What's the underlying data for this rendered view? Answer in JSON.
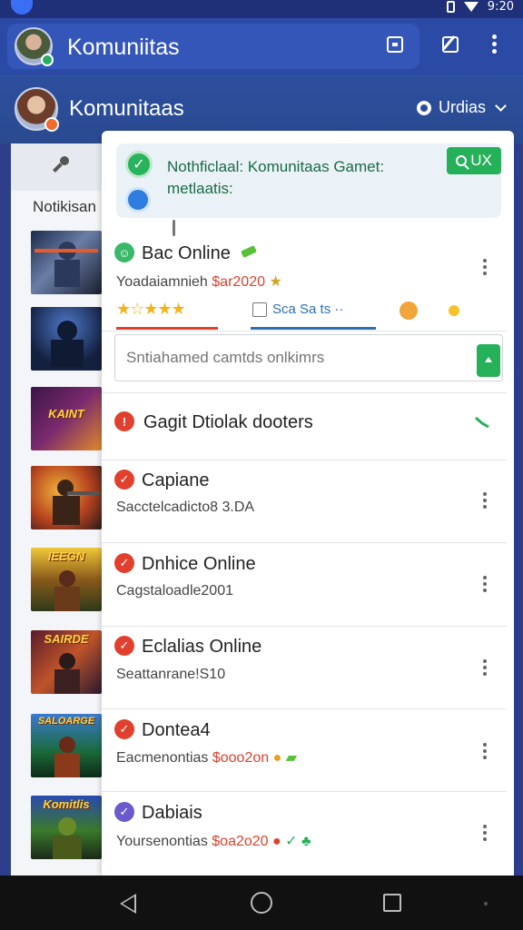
{
  "status_bar": {
    "time": "9:20"
  },
  "app_bar": {
    "title": "Komuniitas"
  },
  "community_bar": {
    "title": "Komunitaas",
    "filter_label": "Urdias"
  },
  "side_section": {
    "label": "Notikisan"
  },
  "notification": {
    "text": "Nothficlaal: Komunitaas Gamet: metlaatis:",
    "button_label": "UX"
  },
  "featured": {
    "title": "Bac Online",
    "subtitle": "Yoadaiamnieh",
    "price": "$ar2020",
    "stars": "★☆★★★",
    "tab_label": "Sca Sa ts ··"
  },
  "search": {
    "placeholder": "Sntiahamed camtds onlkimrs"
  },
  "rows": [
    {
      "title": "Gagit Dtiolak dooters"
    },
    {
      "title": "Capiane",
      "subtitle": "Sacctelcadicto8 3.DA"
    },
    {
      "title": "Dnhice Online",
      "subtitle": "Cagstaloadle2001"
    },
    {
      "title": "Eclalias Online",
      "subtitle": "Seattanrane!S10"
    },
    {
      "title": "Dontea4",
      "subtitle": "Eacmenontias",
      "price": "$ooo2on"
    },
    {
      "title": "Dabiais",
      "subtitle": "Yoursenontias",
      "price": "$oa2o20"
    }
  ],
  "thumbnails": [
    {
      "caption": ""
    },
    {
      "caption": ""
    },
    {
      "caption": "KAINT"
    },
    {
      "caption": ""
    },
    {
      "caption": "IEEGN"
    },
    {
      "caption": "SAIRDE"
    },
    {
      "caption": "SALOARGE"
    },
    {
      "caption": "Komitlis"
    }
  ],
  "colors": {
    "app_bar": "#2b4aa6",
    "accent_green": "#25b05a",
    "status_red": "#e0402d",
    "status_purple": "#6a5acd",
    "link_blue": "#2f6fb5"
  },
  "icons": {
    "app_bar": [
      "avatar",
      "square-icon",
      "edit-icon",
      "kebab-menu-icon"
    ],
    "nav": [
      "back-icon",
      "home-icon",
      "recent-apps-icon"
    ]
  }
}
